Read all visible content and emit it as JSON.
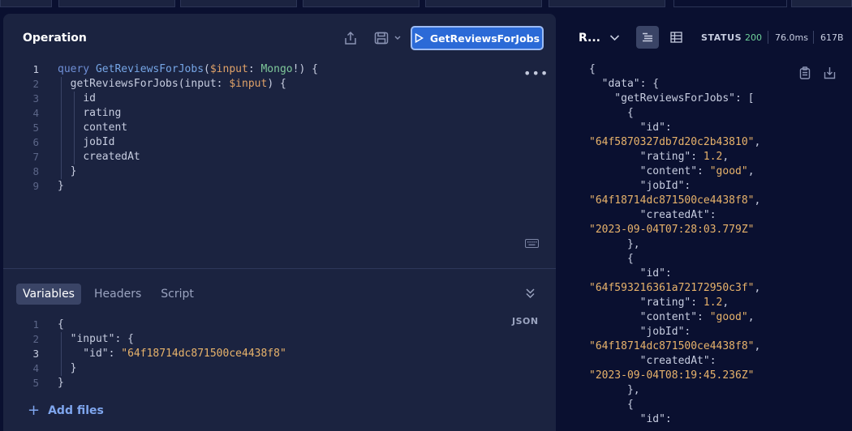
{
  "operation": {
    "title": "Operation",
    "run_label": "GetReviewsForJobs",
    "lines": [
      {
        "num": "1",
        "parts": [
          [
            "kw",
            "query "
          ],
          [
            "fn",
            "GetReviewsForJobs"
          ],
          [
            "plain",
            "("
          ],
          [
            "var",
            "$input"
          ],
          [
            "plain",
            ": "
          ],
          [
            "typ",
            "Mongo"
          ],
          [
            "plain",
            "!) {"
          ]
        ]
      },
      {
        "num": "2",
        "parts": [
          [
            "plain",
            "  "
          ],
          [
            "fld",
            "getReviewsForJobs"
          ],
          [
            "plain",
            "(input: "
          ],
          [
            "var",
            "$input"
          ],
          [
            "plain",
            ") {"
          ]
        ]
      },
      {
        "num": "3",
        "parts": [
          [
            "plain",
            "    "
          ],
          [
            "fld",
            "id"
          ]
        ]
      },
      {
        "num": "4",
        "parts": [
          [
            "plain",
            "    "
          ],
          [
            "fld",
            "rating"
          ]
        ]
      },
      {
        "num": "5",
        "parts": [
          [
            "plain",
            "    "
          ],
          [
            "fld",
            "content"
          ]
        ]
      },
      {
        "num": "6",
        "parts": [
          [
            "plain",
            "    "
          ],
          [
            "fld",
            "jobId"
          ]
        ]
      },
      {
        "num": "7",
        "parts": [
          [
            "plain",
            "    "
          ],
          [
            "fld",
            "createdAt"
          ]
        ]
      },
      {
        "num": "8",
        "parts": [
          [
            "plain",
            "  }"
          ]
        ]
      },
      {
        "num": "9",
        "parts": [
          [
            "plain",
            "}"
          ]
        ]
      }
    ]
  },
  "bottom": {
    "tabs": [
      "Variables",
      "Headers",
      "Script"
    ],
    "active_tab": "Variables",
    "format_label": "JSON",
    "variable_lines": [
      {
        "num": "1",
        "text": "{"
      },
      {
        "num": "2",
        "text": "  \"input\": {"
      },
      {
        "num": "3",
        "text": "    \"id\": \"64f18714dc871500ce4438f8\""
      },
      {
        "num": "4",
        "text": "  }"
      },
      {
        "num": "5",
        "text": "}"
      }
    ],
    "add_files_label": "Add files"
  },
  "response": {
    "title": "R...",
    "status_label": "STATUS",
    "status_code": "200",
    "time": "76.0ms",
    "size": "617B",
    "lines": [
      "{",
      "  \"data\": {",
      "    \"getReviewsForJobs\": [",
      "      {",
      "        \"id\":",
      "\"64f5870327db7d20c2b43810\",",
      "        \"rating\": 1.2,",
      "        \"content\": \"good\",",
      "        \"jobId\":",
      "\"64f18714dc871500ce4438f8\",",
      "        \"createdAt\":",
      "\"2023-09-04T07:28:03.779Z\"",
      "      },",
      "      {",
      "        \"id\":",
      "\"64f593216361a72172950c3f\",",
      "        \"rating\": 1.2,",
      "        \"content\": \"good\",",
      "        \"jobId\":",
      "\"64f18714dc871500ce4438f8\",",
      "        \"createdAt\":",
      "\"2023-09-04T08:19:45.236Z\"",
      "      },",
      "      {",
      "        \"id\":"
    ]
  }
}
